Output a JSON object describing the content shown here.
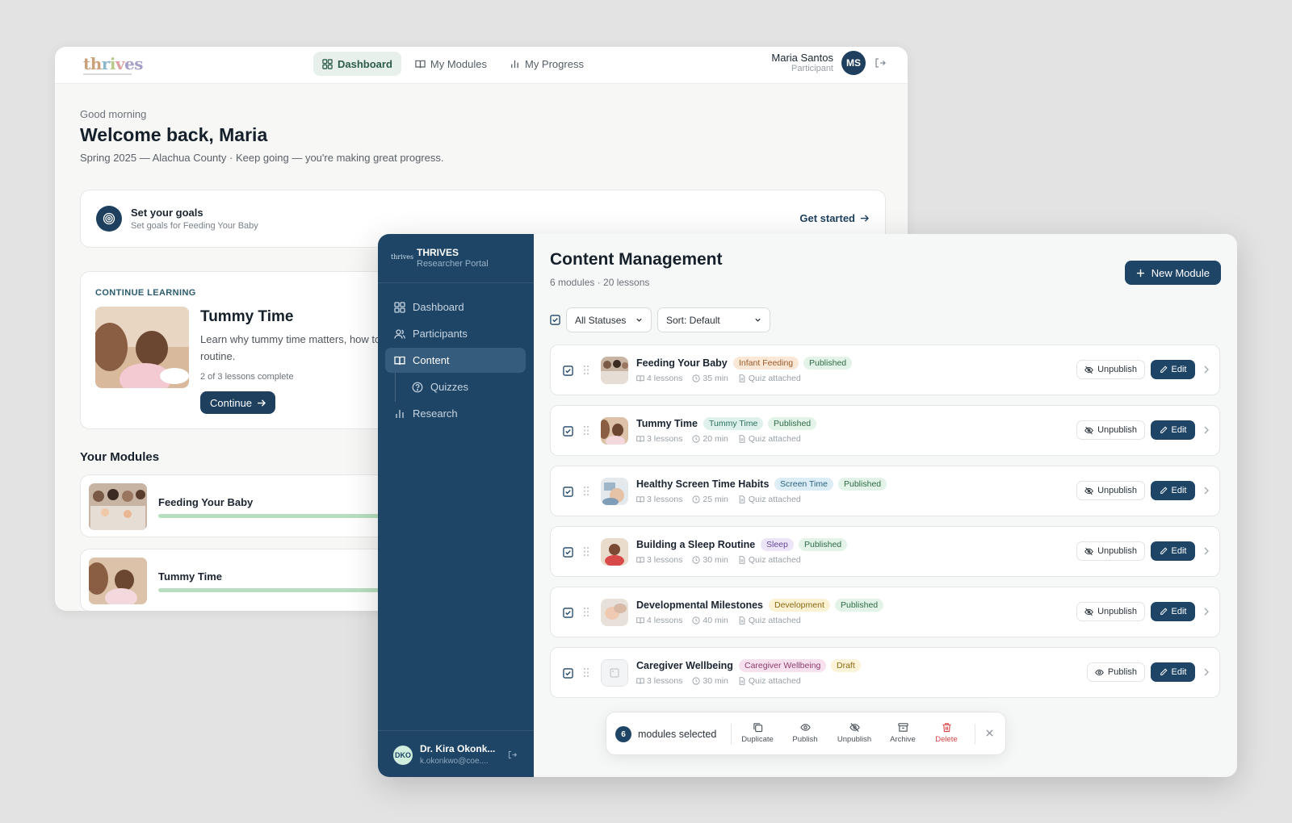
{
  "participant": {
    "nav": [
      {
        "label": "Dashboard",
        "icon": "grid-icon",
        "active": true
      },
      {
        "label": "My Modules",
        "icon": "book-icon",
        "active": false
      },
      {
        "label": "My Progress",
        "icon": "bar-chart-icon",
        "active": false
      }
    ],
    "user": {
      "name": "Maria Santos",
      "role": "Participant",
      "initials": "MS"
    },
    "greeting": "Good morning",
    "welcome": "Welcome back, Maria",
    "subtitle": "Spring 2025 — Alachua County · Keep going — you're making great progress.",
    "goals": {
      "title": "Set your goals",
      "subtitle": "Set goals for Feeding Your Baby",
      "cta": "Get started"
    },
    "continue": {
      "label": "CONTINUE LEARNING",
      "title": "Tummy Time",
      "description": "Learn why tummy time matters, how to safely into your daily routine.",
      "progress": "2 of 3 lessons complete",
      "button": "Continue"
    },
    "your_modules_title": "Your Modules",
    "modules": [
      {
        "name": "Feeding Your Baby"
      },
      {
        "name": "Tummy Time"
      }
    ]
  },
  "researcher": {
    "brand": {
      "logo": "thrives",
      "name": "THRIVES",
      "subtitle": "Researcher Portal"
    },
    "nav": [
      {
        "label": "Dashboard",
        "icon": "grid-icon"
      },
      {
        "label": "Participants",
        "icon": "users-icon"
      },
      {
        "label": "Content",
        "icon": "book-icon",
        "active": true
      },
      {
        "label": "Quizzes",
        "icon": "help-circle-icon"
      },
      {
        "label": "Research",
        "icon": "bar-chart-icon"
      }
    ],
    "user": {
      "initials": "DKO",
      "name": "Dr. Kira Okonk...",
      "email": "k.okonkwo@coe...."
    },
    "title": "Content Management",
    "summary": "6 modules · 20 lessons",
    "new_module": "New Module",
    "filters": {
      "status": "All Statuses",
      "sort": "Sort: Default"
    },
    "rows": [
      {
        "name": "Feeding Your Baby",
        "category": "Infant Feeding",
        "cat_bg": "#fbe7d6",
        "cat_fg": "#9a5a2a",
        "status": "Published",
        "lessons": "4 lessons",
        "duration": "35 min",
        "quiz": "Quiz attached",
        "action": "Unpublish",
        "edit": "Edit"
      },
      {
        "name": "Tummy Time",
        "category": "Tummy Time",
        "cat_bg": "#dff1ec",
        "cat_fg": "#2a7060",
        "status": "Published",
        "lessons": "3 lessons",
        "duration": "20 min",
        "quiz": "Quiz attached",
        "action": "Unpublish",
        "edit": "Edit"
      },
      {
        "name": "Healthy Screen Time Habits",
        "category": "Screen Time",
        "cat_bg": "#dcedf5",
        "cat_fg": "#2a6383",
        "status": "Published",
        "lessons": "3 lessons",
        "duration": "25 min",
        "quiz": "Quiz attached",
        "action": "Unpublish",
        "edit": "Edit"
      },
      {
        "name": "Building a Sleep Routine",
        "category": "Sleep",
        "cat_bg": "#ece4f7",
        "cat_fg": "#65479a",
        "status": "Published",
        "lessons": "3 lessons",
        "duration": "30 min",
        "quiz": "Quiz attached",
        "action": "Unpublish",
        "edit": "Edit"
      },
      {
        "name": "Developmental Milestones",
        "category": "Development",
        "cat_bg": "#fbf2d3",
        "cat_fg": "#8a6a12",
        "status": "Published",
        "lessons": "4 lessons",
        "duration": "40 min",
        "quiz": "Quiz attached",
        "action": "Unpublish",
        "edit": "Edit"
      },
      {
        "name": "Caregiver Wellbeing",
        "category": "Caregiver Wellbeing",
        "cat_bg": "#f7e1ef",
        "cat_fg": "#8e3c6e",
        "status": "Draft",
        "lessons": "3 lessons",
        "duration": "30 min",
        "quiz": "Quiz attached",
        "action": "Publish",
        "edit": "Edit"
      }
    ],
    "bulk": {
      "count": "6",
      "label": "modules selected",
      "actions": [
        "Duplicate",
        "Publish",
        "Unpublish",
        "Archive",
        "Delete"
      ]
    }
  },
  "colors": {
    "navy": "#1e4466",
    "published_bg": "#e3f3e8",
    "published_fg": "#2d6b45",
    "draft_bg": "#fdf3d8",
    "draft_fg": "#8a6a12",
    "delete": "#d64545"
  }
}
